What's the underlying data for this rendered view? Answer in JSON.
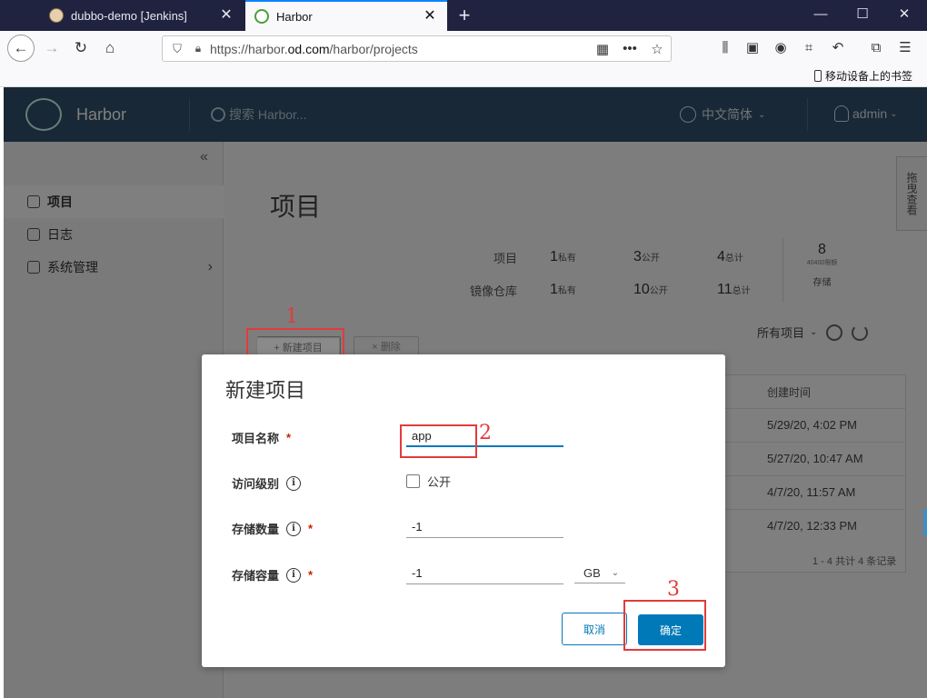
{
  "browser": {
    "tabs": [
      {
        "label": "dubbo-demo [Jenkins]",
        "active": false
      },
      {
        "label": "Harbor",
        "active": true
      }
    ],
    "url_prefix": "https://harbor.",
    "url_domain": "od.com",
    "url_path": "/harbor/projects",
    "bookmark_item": "移动设备上的书签"
  },
  "harbor": {
    "brand": "Harbor",
    "search_placeholder": "搜索 Harbor...",
    "language": "中文简体",
    "user": "admin",
    "header_color": "#30516c",
    "sidebar": [
      {
        "label": "项目",
        "active": true
      },
      {
        "label": "日志",
        "active": false
      },
      {
        "label": "系统管理",
        "active": false
      }
    ],
    "page_title": "项目",
    "stats": {
      "projects_label": "项目",
      "repos_label": "镜像仓库",
      "private_label": "私有",
      "public_label": "公开",
      "total_label": "总计",
      "projects_private": "1",
      "projects_public": "3",
      "projects_total": "4",
      "repos_private": "1",
      "repos_public": "10",
      "repos_total": "11",
      "storage_value": "8",
      "storage_sub": "40400限额",
      "storage_label": "存储"
    },
    "new_project_button": "+ 新建项目",
    "delete_button": "× 删除",
    "filter_label": "所有项目",
    "table": {
      "created_header": "创建时间",
      "rows": [
        "5/29/20, 4:02 PM",
        "5/27/20, 10:47 AM",
        "4/7/20, 11:57 AM",
        "4/7/20, 12:33 PM"
      ],
      "footer": "1 - 4 共计 4 条记录"
    },
    "side_tab": "拖曳查看"
  },
  "modal": {
    "title": "新建项目",
    "name_label": "项目名称",
    "name_value": "app",
    "access_label": "访问级别",
    "public_label": "公开",
    "count_label": "存储数量",
    "count_value": "-1",
    "capacity_label": "存储容量",
    "capacity_value": "-1",
    "unit": "GB",
    "cancel": "取消",
    "confirm": "确定",
    "primary_color": "#0079b8"
  },
  "annotations": [
    "1",
    "2",
    "3"
  ]
}
